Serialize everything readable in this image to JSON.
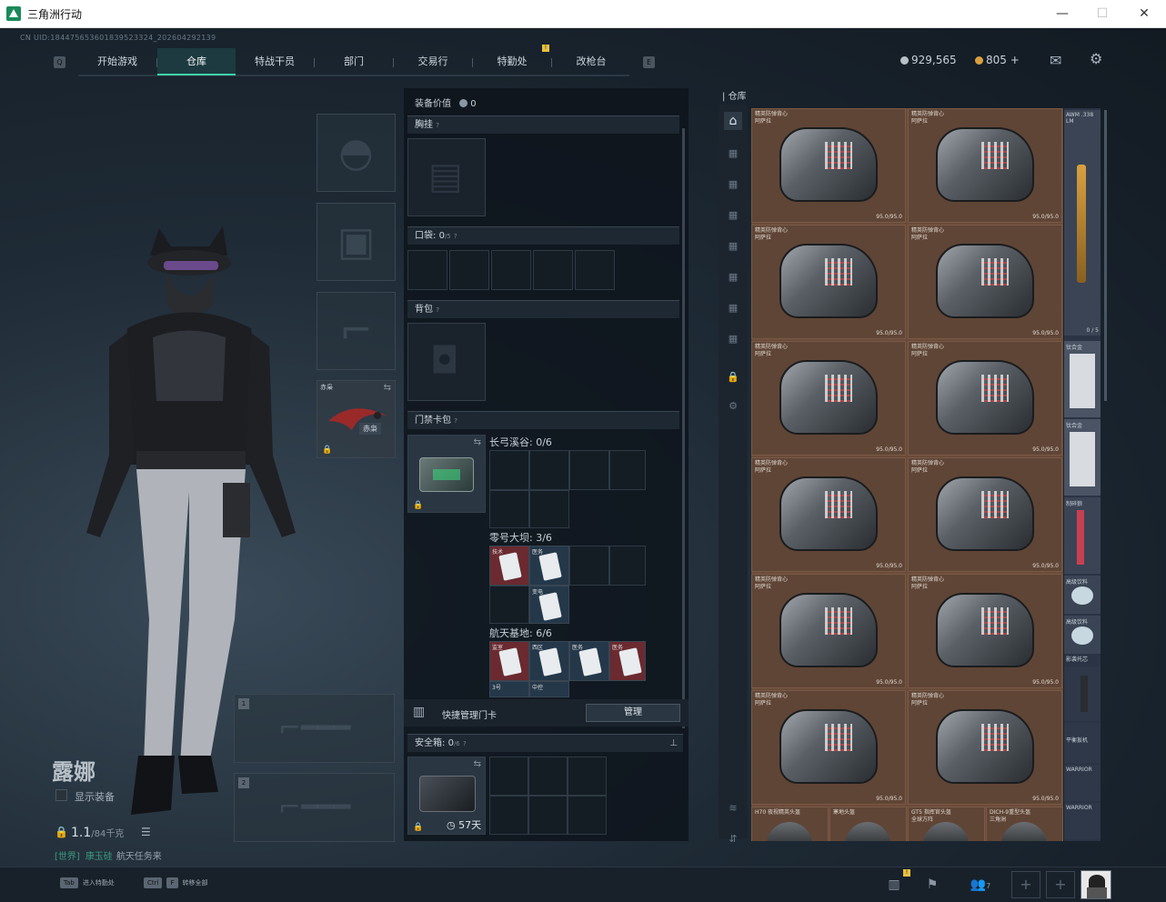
{
  "window": {
    "title": "三角洲行动",
    "minimize": "—",
    "maximize": "☐",
    "close": "✕"
  },
  "uid": "CN UID:1844756536018395233​24_202604292139",
  "nav": {
    "tabs": [
      {
        "label": "开始游戏"
      },
      {
        "label": "仓库",
        "active": true
      },
      {
        "label": "特战干员"
      },
      {
        "label": "部门"
      },
      {
        "label": "交易行"
      },
      {
        "label": "特勤处"
      },
      {
        "label": "改枪台"
      }
    ],
    "left_key": "Q",
    "right_key": "E",
    "badge": "!"
  },
  "currency": {
    "silver": "929,565",
    "gold": "805",
    "plus": "+"
  },
  "character": {
    "name": "露娜",
    "show_equipment": "显示装备",
    "weight": "1.1",
    "weight_max": "/84千克",
    "chat_channel": "[世界]",
    "chat_user": "康玉硅",
    "chat_text": "航天任务来"
  },
  "melee": {
    "label": "赤枭",
    "tag": "赤枭"
  },
  "weapon_slots": [
    "1",
    "2"
  ],
  "equipment": {
    "value_label": "装备价值",
    "value": "0",
    "chest_rig": "胸挂",
    "pockets": "口袋:",
    "pockets_count": "0",
    "pockets_max": "/5",
    "backpack": "背包",
    "keycard_case": "门禁卡包",
    "help": "?",
    "maps": [
      {
        "name": "长弓溪谷: 0/6"
      },
      {
        "name": "零号大坝: 3/6"
      },
      {
        "name": "航天基地: 6/6"
      }
    ],
    "dam_cards": [
      "技术",
      "医务",
      "变电"
    ],
    "space_cards": [
      "监室",
      "西区",
      "医务",
      "医务",
      "3号",
      "中控"
    ],
    "quick_manage": "快捷管理门卡",
    "manage_btn": "管理",
    "safe_box": "安全箱:",
    "safe_count": "0",
    "safe_max": "/6",
    "safe_days": "57天"
  },
  "storage": {
    "title": "仓库",
    "item_name_1": "精英防弹背心",
    "item_name_2": "阿萨拉",
    "durability": "95.0/95.0",
    "right_items": [
      "AWM .338 LM",
      "0 / 5",
      "钛合金",
      "钛合金",
      "制碎狼",
      "高级饮料",
      "高级饮料",
      "影袭托芯",
      "平衡扳机",
      "WARRIOR",
      "WARRIOR"
    ],
    "bottom_items": [
      "H70 夜视精英头盔",
      "寒地头盔",
      "GT5 指挥官头盔",
      "DICH-9重型头盔"
    ],
    "bottom_sub": [
      "",
      "",
      "全球方阵",
      "三角洲"
    ]
  },
  "bottom_bar": {
    "key1": "Tab",
    "key1_label": "进入特勤处",
    "key2": "Ctrl",
    "key2b": "F",
    "key2_label": "转移全部",
    "friends": "7",
    "badge": "!"
  }
}
